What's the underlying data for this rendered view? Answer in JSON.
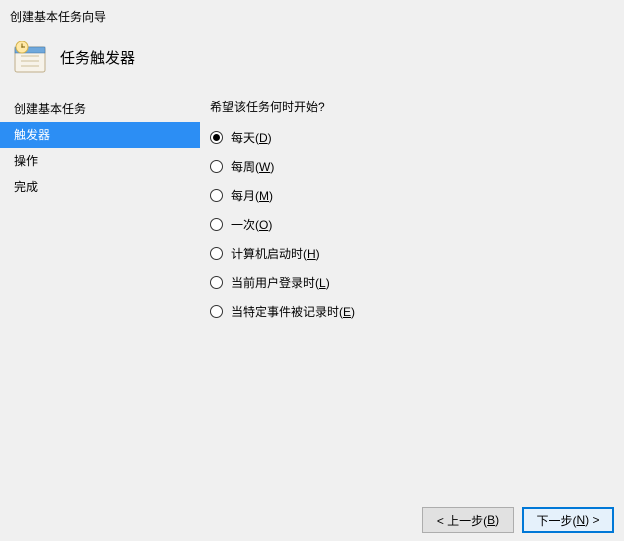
{
  "window": {
    "title": "创建基本任务向导"
  },
  "header": {
    "title": "任务触发器"
  },
  "sidebar": {
    "items": [
      {
        "label": "创建基本任务",
        "selected": false
      },
      {
        "label": "触发器",
        "selected": true
      },
      {
        "label": "操作",
        "selected": false
      },
      {
        "label": "完成",
        "selected": false
      }
    ]
  },
  "content": {
    "heading": "希望该任务何时开始?",
    "options": [
      {
        "text": "每天(",
        "key": "D",
        "suffix": ")",
        "checked": true
      },
      {
        "text": "每周(",
        "key": "W",
        "suffix": ")",
        "checked": false
      },
      {
        "text": "每月(",
        "key": "M",
        "suffix": ")",
        "checked": false
      },
      {
        "text": "一次(",
        "key": "O",
        "suffix": ")",
        "checked": false
      },
      {
        "text": "计算机启动时(",
        "key": "H",
        "suffix": ")",
        "checked": false
      },
      {
        "text": "当前用户登录时(",
        "key": "L",
        "suffix": ")",
        "checked": false
      },
      {
        "text": "当特定事件被记录时(",
        "key": "E",
        "suffix": ")",
        "checked": false
      }
    ]
  },
  "footer": {
    "back": {
      "prefix": "< 上一步(",
      "key": "B",
      "suffix": ")"
    },
    "next": {
      "prefix": "下一步(",
      "key": "N",
      "suffix": ") >"
    }
  }
}
